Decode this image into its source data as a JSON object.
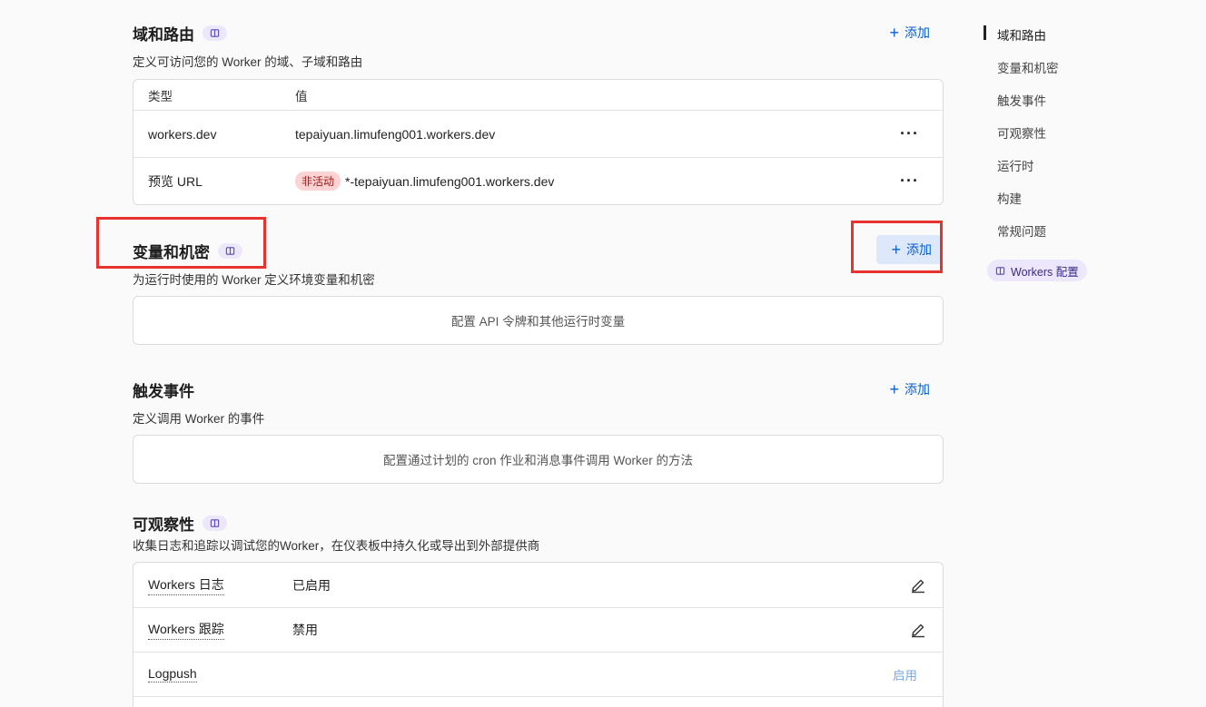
{
  "domains": {
    "title": "域和路由",
    "add_label": "添加",
    "description": "定义可访问您的 Worker 的域、子域和路由",
    "columns": [
      "类型",
      "值"
    ],
    "rows": [
      {
        "type": "workers.dev",
        "value": "tepaiyuan.limufeng001.workers.dev",
        "badge": ""
      },
      {
        "type": "预览 URL",
        "value": "*-tepaiyuan.limufeng001.workers.dev",
        "badge": "非活动"
      }
    ]
  },
  "variables": {
    "title": "变量和机密",
    "add_label": "添加",
    "description": "为运行时使用的 Worker 定义环境变量和机密",
    "empty_text": "配置 API 令牌和其他运行时变量"
  },
  "triggers": {
    "title": "触发事件",
    "add_label": "添加",
    "description": "定义调用 Worker 的事件",
    "empty_text": "配置通过计划的 cron 作业和消息事件调用 Worker 的方法"
  },
  "observability": {
    "title": "可观察性",
    "description": "收集日志和追踪以调试您的Worker，在仪表板中持久化或导出到外部提供商",
    "rows": [
      {
        "label": "Workers 日志",
        "value": "已启用",
        "action": "edit-icon"
      },
      {
        "label": "Workers 跟踪",
        "value": "禁用",
        "action": "edit-icon"
      },
      {
        "label": "Logpush",
        "value": "",
        "action_label": "启用"
      }
    ]
  },
  "toc": {
    "items": [
      "域和路由",
      "变量和机密",
      "触发事件",
      "可观察性",
      "运行时",
      "构建",
      "常规问题"
    ],
    "active_index": 0,
    "docs_label": "Workers 配置"
  },
  "colors": {
    "accent": "#0a5fcf",
    "highlight_border": "#e8322d",
    "badge_bg": "#fbd3d3",
    "pill_bg": "#ece7fa"
  }
}
